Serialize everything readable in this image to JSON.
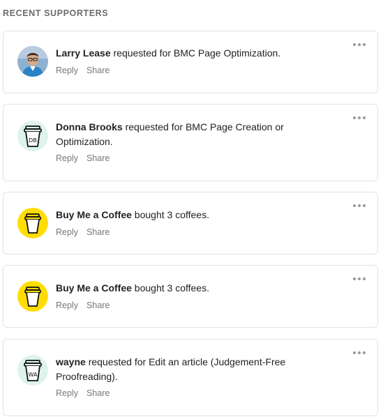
{
  "section_title": "RECENT SUPPORTERS",
  "supporters": [
    {
      "name": "Larry Lease",
      "text": " requested for BMC Page Optimization.",
      "avatar": "photo",
      "reply": "Reply",
      "share": "Share"
    },
    {
      "name": "Donna Brooks",
      "text": " requested for BMC Page Creation or Optimization.",
      "avatar": "cup-initials",
      "initials": "DB",
      "reply": "Reply",
      "share": "Share"
    },
    {
      "name": "Buy Me a Coffee",
      "text": " bought 3 coffees.",
      "avatar": "cup-yellow",
      "reply": "Reply",
      "share": "Share"
    },
    {
      "name": "Buy Me a Coffee",
      "text": " bought 3 coffees.",
      "avatar": "cup-yellow",
      "reply": "Reply",
      "share": "Share"
    },
    {
      "name": "wayne",
      "text": " requested for Edit an article (Judgement-Free Proofreading).",
      "avatar": "cup-initials",
      "initials": "WA",
      "reply": "Reply",
      "share": "Share"
    }
  ],
  "colors": {
    "yellow": "#FFDD00",
    "mint": "#DDF3EC",
    "muted": "#777777"
  },
  "icons": {
    "more": "more-horizontal-icon"
  }
}
